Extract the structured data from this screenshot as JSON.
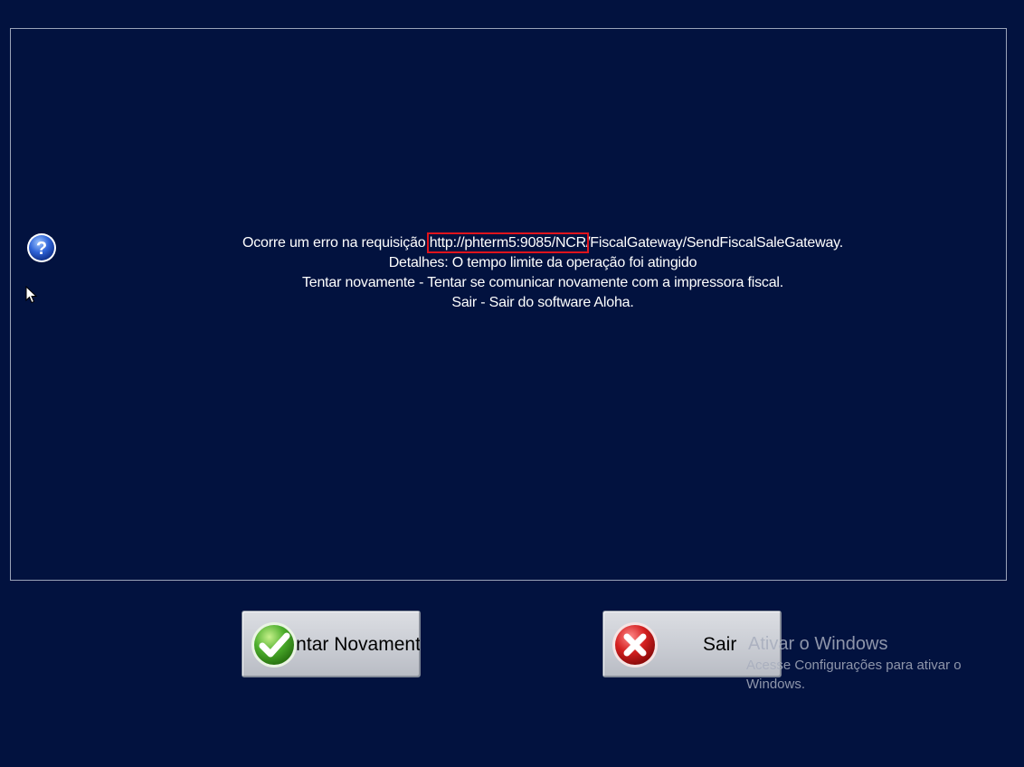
{
  "message": {
    "line1_prefix": "Ocorre um erro na requisição ",
    "line1_url_highlight": "http://phterm5:9085/NCR",
    "line1_suffix": "/FiscalGateway/SendFiscalSaleGateway.",
    "line2": "Detalhes: O tempo limite da operação foi atingido",
    "line3": "Tentar novamente - Tentar se comunicar novamente com a impressora fiscal.",
    "line4": "Sair - Sair do software Aloha."
  },
  "buttons": {
    "retry_label": "Tentar Novamente",
    "exit_label": "Sair"
  },
  "watermark": {
    "title": "Ativar o Windows",
    "subtitle": "Acesse Configurações para ativar o Windows."
  },
  "colors": {
    "background": "#02123f",
    "highlight_border": "#e0141c",
    "text": "#ffffff"
  },
  "icons": {
    "dialog": "question-icon",
    "retry": "checkmark-icon",
    "exit": "close-icon",
    "pointer": "mouse-cursor-icon"
  }
}
